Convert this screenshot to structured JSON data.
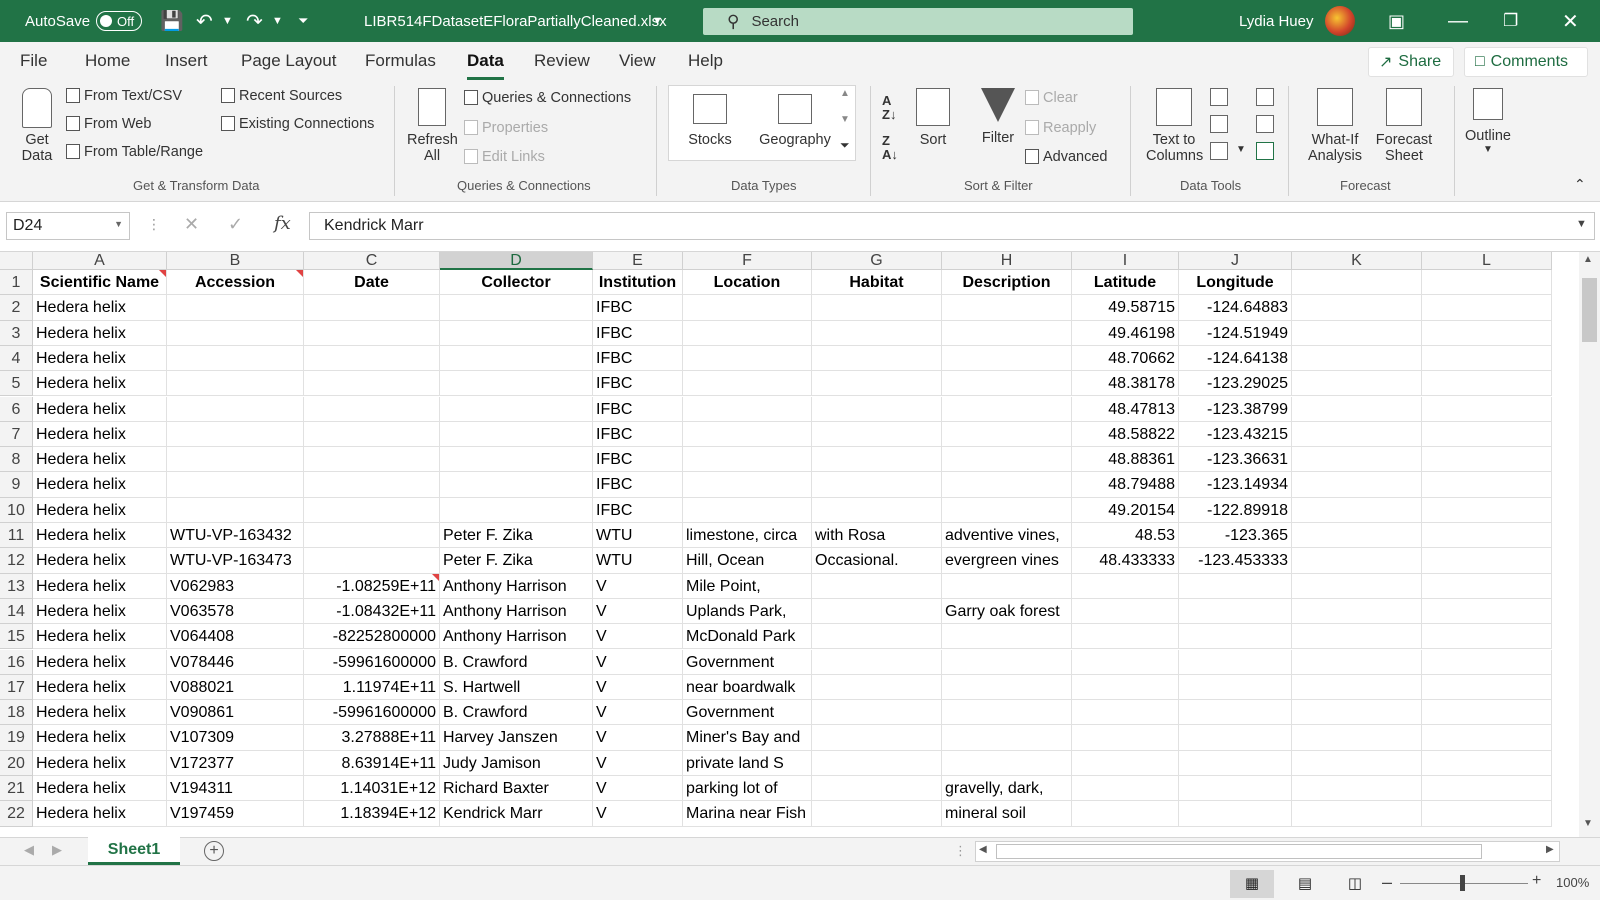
{
  "titlebar": {
    "autosave_label": "AutoSave",
    "autosave_state": "Off",
    "filename": "LIBR514FDatasetEFloraPartiallyCleaned.xlsx",
    "search_placeholder": "Search",
    "user_name": "Lydia Huey"
  },
  "menu": {
    "tabs": [
      "File",
      "Home",
      "Insert",
      "Page Layout",
      "Formulas",
      "Data",
      "Review",
      "View",
      "Help"
    ],
    "active_tab": "Data",
    "share_label": "Share",
    "comments_label": "Comments"
  },
  "ribbon": {
    "get_data_1": "Get",
    "get_data_2": "Data",
    "from_text": "From Text/CSV",
    "from_web": "From Web",
    "from_table": "From Table/Range",
    "recent_sources": "Recent Sources",
    "existing_connections": "Existing Connections",
    "group_get_transform": "Get & Transform Data",
    "refresh_1": "Refresh",
    "refresh_2": "All",
    "queries_connections": "Queries & Connections",
    "properties": "Properties",
    "edit_links": "Edit Links",
    "group_queries": "Queries & Connections",
    "stocks": "Stocks",
    "geography": "Geography",
    "group_data_types": "Data Types",
    "sort": "Sort",
    "filter": "Filter",
    "clear": "Clear",
    "reapply": "Reapply",
    "advanced": "Advanced",
    "group_sort_filter": "Sort & Filter",
    "text_to_1": "Text to",
    "text_to_2": "Columns",
    "group_data_tools": "Data Tools",
    "whatif_1": "What-If",
    "whatif_2": "Analysis",
    "forecast_1": "Forecast",
    "forecast_2": "Sheet",
    "group_forecast": "Forecast",
    "outline": "Outline"
  },
  "formula_bar": {
    "name_box": "D24",
    "content": "Kendrick Marr"
  },
  "columns": [
    "A",
    "B",
    "C",
    "D",
    "E",
    "F",
    "G",
    "H",
    "I",
    "J",
    "K",
    "L"
  ],
  "selected_column": "D",
  "rows": [
    {
      "n": "1",
      "A": "Scientific Name",
      "B": "Accession",
      "C": "Date",
      "D": "Collector",
      "E": "Institution",
      "F": "Location",
      "G": "Habitat",
      "H": "Description",
      "I": "Latitude",
      "J": "Longitude"
    },
    {
      "n": "2",
      "A": "Hedera helix",
      "B": "",
      "C": "",
      "D": "",
      "E": "IFBC",
      "F": "",
      "G": "",
      "H": "",
      "I": "49.58715",
      "J": "-124.64883"
    },
    {
      "n": "3",
      "A": "Hedera helix",
      "B": "",
      "C": "",
      "D": "",
      "E": "IFBC",
      "F": "",
      "G": "",
      "H": "",
      "I": "49.46198",
      "J": "-124.51949"
    },
    {
      "n": "4",
      "A": "Hedera helix",
      "B": "",
      "C": "",
      "D": "",
      "E": "IFBC",
      "F": "",
      "G": "",
      "H": "",
      "I": "48.70662",
      "J": "-124.64138"
    },
    {
      "n": "5",
      "A": "Hedera helix",
      "B": "",
      "C": "",
      "D": "",
      "E": "IFBC",
      "F": "",
      "G": "",
      "H": "",
      "I": "48.38178",
      "J": "-123.29025"
    },
    {
      "n": "6",
      "A": "Hedera helix",
      "B": "",
      "C": "",
      "D": "",
      "E": "IFBC",
      "F": "",
      "G": "",
      "H": "",
      "I": "48.47813",
      "J": "-123.38799"
    },
    {
      "n": "7",
      "A": "Hedera helix",
      "B": "",
      "C": "",
      "D": "",
      "E": "IFBC",
      "F": "",
      "G": "",
      "H": "",
      "I": "48.58822",
      "J": "-123.43215"
    },
    {
      "n": "8",
      "A": "Hedera helix",
      "B": "",
      "C": "",
      "D": "",
      "E": "IFBC",
      "F": "",
      "G": "",
      "H": "",
      "I": "48.88361",
      "J": "-123.36631"
    },
    {
      "n": "9",
      "A": "Hedera helix",
      "B": "",
      "C": "",
      "D": "",
      "E": "IFBC",
      "F": "",
      "G": "",
      "H": "",
      "I": "48.79488",
      "J": "-123.14934"
    },
    {
      "n": "10",
      "A": "Hedera helix",
      "B": "",
      "C": "",
      "D": "",
      "E": "IFBC",
      "F": "",
      "G": "",
      "H": "",
      "I": "49.20154",
      "J": "-122.89918"
    },
    {
      "n": "11",
      "A": "Hedera helix",
      "B": "WTU-VP-163432",
      "C": "",
      "D": "Peter F. Zika",
      "E": "WTU",
      "F": "limestone, circa",
      "G": "with Rosa",
      "H": "adventive vines,",
      "I": "48.53",
      "J": "-123.365"
    },
    {
      "n": "12",
      "A": "Hedera helix",
      "B": "WTU-VP-163473",
      "C": "",
      "D": "Peter F. Zika",
      "E": "WTU",
      "F": "Hill, Ocean",
      "G": "Occasional.",
      "H": "evergreen vines",
      "I": "48.433333",
      "J": "-123.453333"
    },
    {
      "n": "13",
      "A": "Hedera helix",
      "B": "V062983",
      "C": "-1.08259E+11",
      "D": "Anthony Harrison",
      "E": "V",
      "F": "Mile Point,",
      "G": "",
      "H": "",
      "I": "",
      "J": ""
    },
    {
      "n": "14",
      "A": "Hedera helix",
      "B": "V063578",
      "C": "-1.08432E+11",
      "D": "Anthony Harrison",
      "E": "V",
      "F": "Uplands Park,",
      "G": "",
      "H": "Garry oak forest",
      "I": "",
      "J": ""
    },
    {
      "n": "15",
      "A": "Hedera helix",
      "B": "V064408",
      "C": "-82252800000",
      "D": "Anthony Harrison",
      "E": "V",
      "F": "McDonald Park",
      "G": "",
      "H": "",
      "I": "",
      "J": ""
    },
    {
      "n": "16",
      "A": "Hedera helix",
      "B": "V078446",
      "C": "-59961600000",
      "D": "B. Crawford",
      "E": "V",
      "F": "Government",
      "G": "",
      "H": "",
      "I": "",
      "J": ""
    },
    {
      "n": "17",
      "A": "Hedera helix",
      "B": "V088021",
      "C": "1.11974E+11",
      "D": "S. Hartwell",
      "E": "V",
      "F": "near boardwalk",
      "G": "",
      "H": "",
      "I": "",
      "J": ""
    },
    {
      "n": "18",
      "A": "Hedera helix",
      "B": "V090861",
      "C": "-59961600000",
      "D": "B. Crawford",
      "E": "V",
      "F": "Government",
      "G": "",
      "H": "",
      "I": "",
      "J": ""
    },
    {
      "n": "19",
      "A": "Hedera helix",
      "B": "V107309",
      "C": "3.27888E+11",
      "D": "Harvey Janszen",
      "E": "V",
      "F": "Miner's Bay and",
      "G": "",
      "H": "",
      "I": "",
      "J": ""
    },
    {
      "n": "20",
      "A": "Hedera helix",
      "B": "V172377",
      "C": "8.63914E+11",
      "D": "Judy Jamison",
      "E": "V",
      "F": "private land S",
      "G": "",
      "H": "",
      "I": "",
      "J": ""
    },
    {
      "n": "21",
      "A": "Hedera helix",
      "B": "V194311",
      "C": "1.14031E+12",
      "D": "Richard Baxter",
      "E": "V",
      "F": "parking lot of",
      "G": "",
      "H": "gravelly, dark,",
      "I": "",
      "J": ""
    },
    {
      "n": "22",
      "A": "Hedera helix",
      "B": "V197459",
      "C": "1.18394E+12",
      "D": "Kendrick Marr",
      "E": "V",
      "F": "Marina near Fish",
      "G": "",
      "H": "mineral soil",
      "I": "",
      "J": ""
    }
  ],
  "sheet_tab": "Sheet1",
  "zoom": "100%"
}
